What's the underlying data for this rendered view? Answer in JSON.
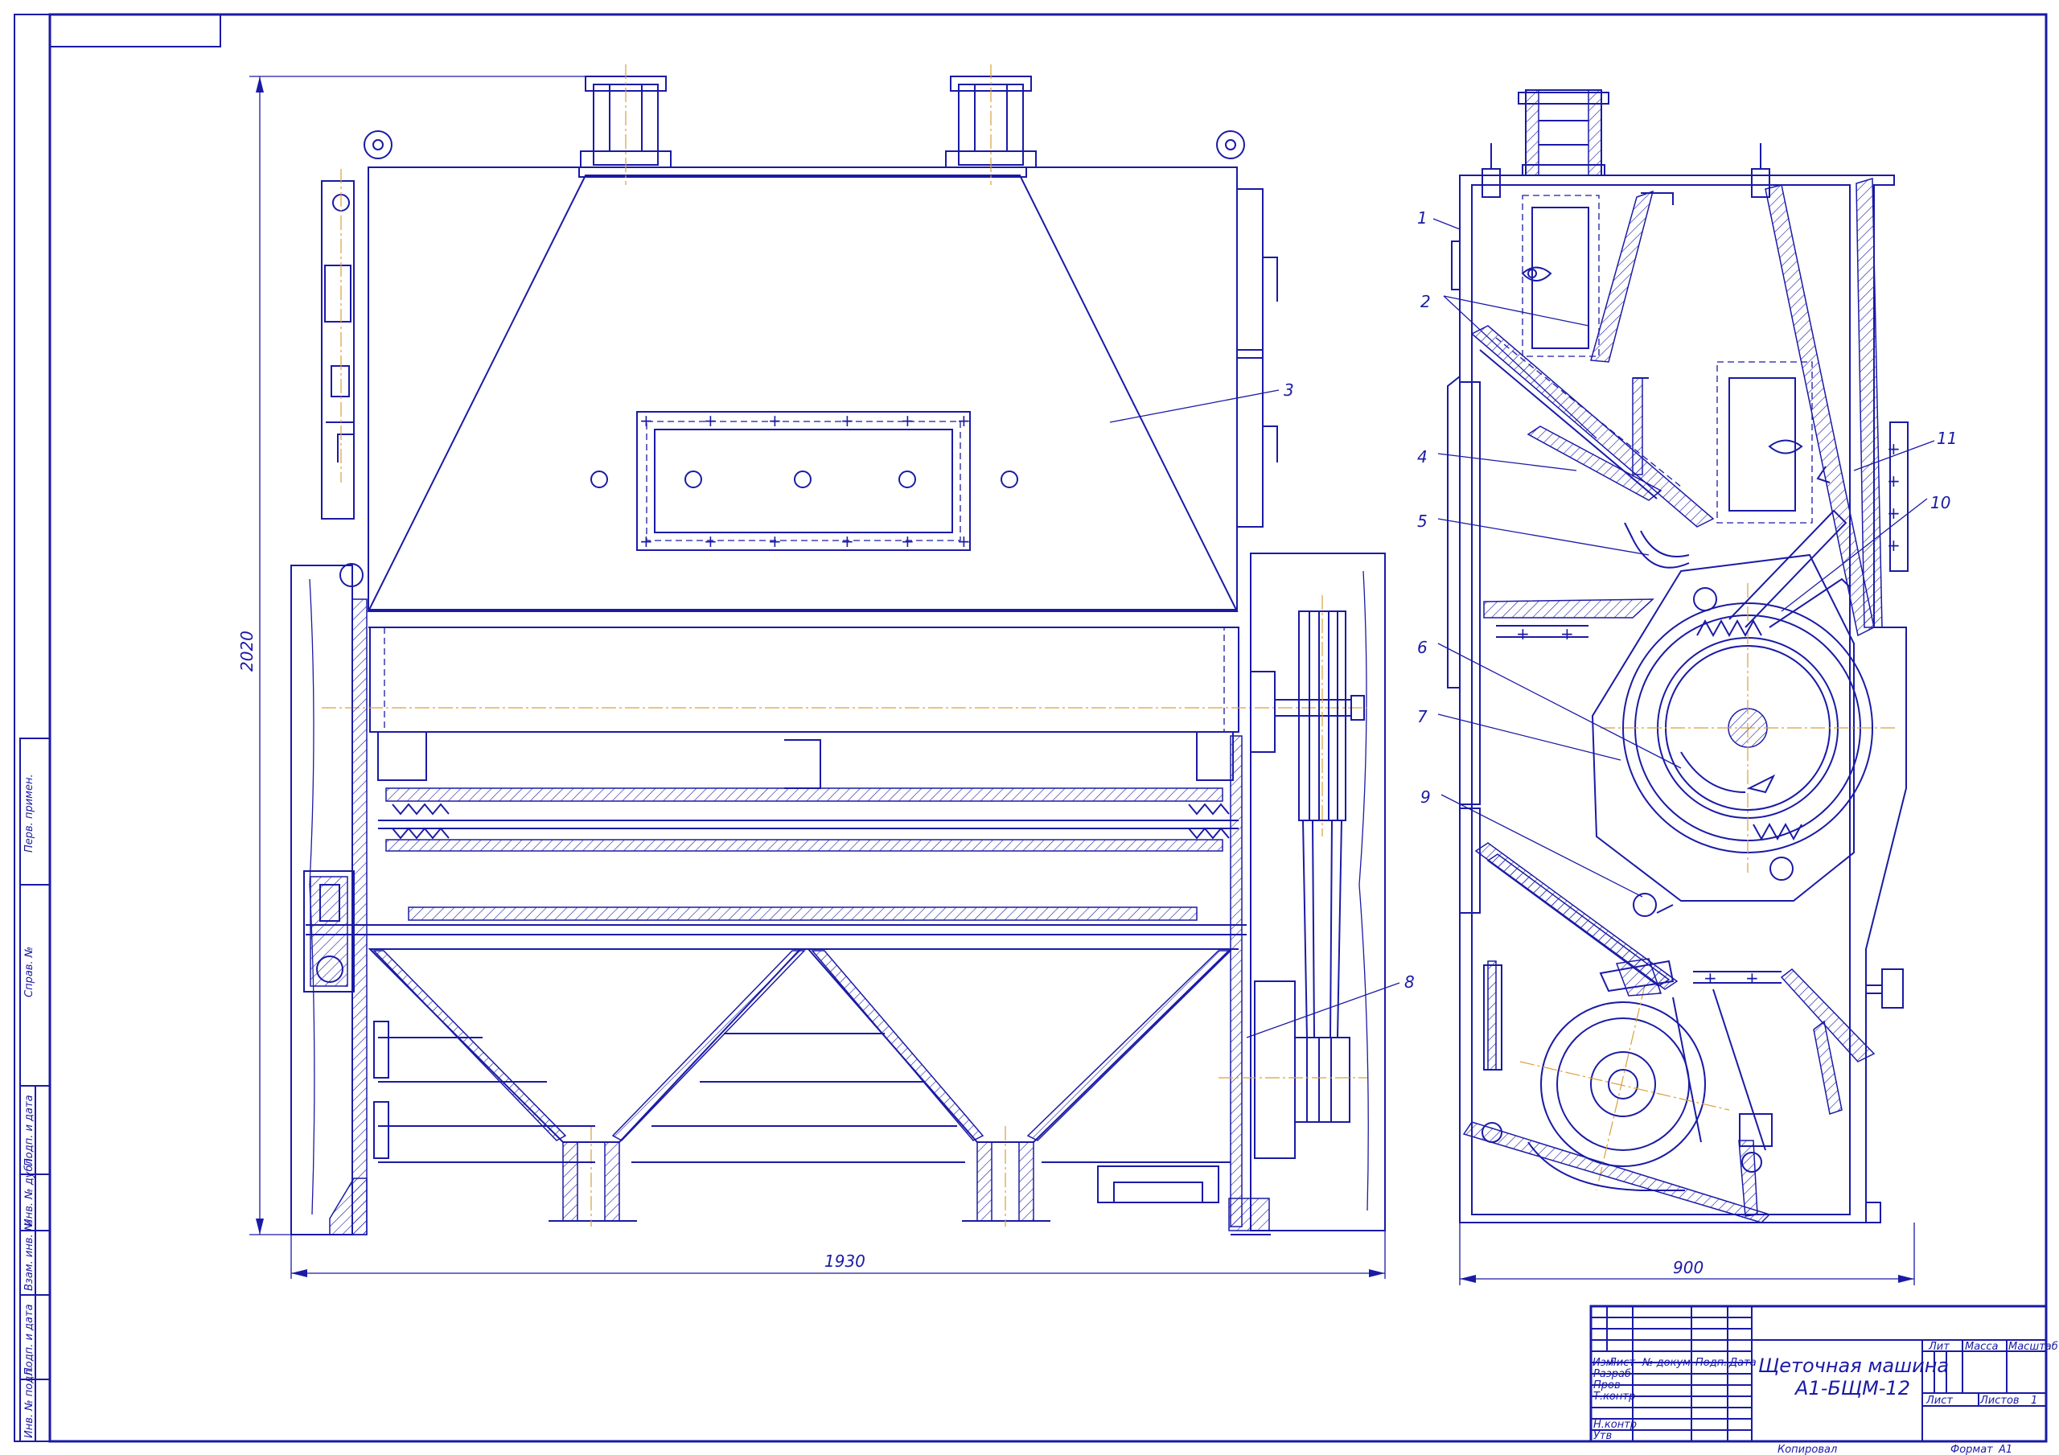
{
  "title_block": {
    "title_line1": "Щеточная машина",
    "title_line2": "А1-БЩМ-12",
    "col_izm": "Изм",
    "col_list": "Лист",
    "col_doc": "№ докум.",
    "col_sign": "Подп.",
    "col_date": "Дата",
    "row_razrab": "Разраб",
    "row_prov": "Пров",
    "row_tkontr": "Т.контр",
    "row_nkontr": "Н.контр",
    "row_utv": "Утв",
    "lit": "Лит",
    "massa": "Масса",
    "masshtab": "Масштаб",
    "list": "Лист",
    "listov": "Листов",
    "listov_value": "1",
    "kopiroval": "Копировал",
    "format": "Формат",
    "format_value": "А1"
  },
  "side_stamp": {
    "perv_primen": "Перв. примен.",
    "sprav_no": "Справ. №",
    "podp_data_1": "Подп. и дата",
    "inv_dubl": "Инв. № дубл.",
    "vzam_inv": "Взам. инв. №",
    "podp_data_2": "Подп. и дата",
    "inv_podl": "Инв. № подл."
  },
  "dimensions": {
    "height_main": "2020",
    "width_main": "1930",
    "width_side": "900"
  },
  "callouts": [
    "1",
    "2",
    "3",
    "4",
    "5",
    "6",
    "7",
    "8",
    "9",
    "10",
    "11"
  ],
  "colors": {
    "line": "#1a1aa6",
    "center_line": "#d9a03a",
    "background": "#ffffff"
  }
}
